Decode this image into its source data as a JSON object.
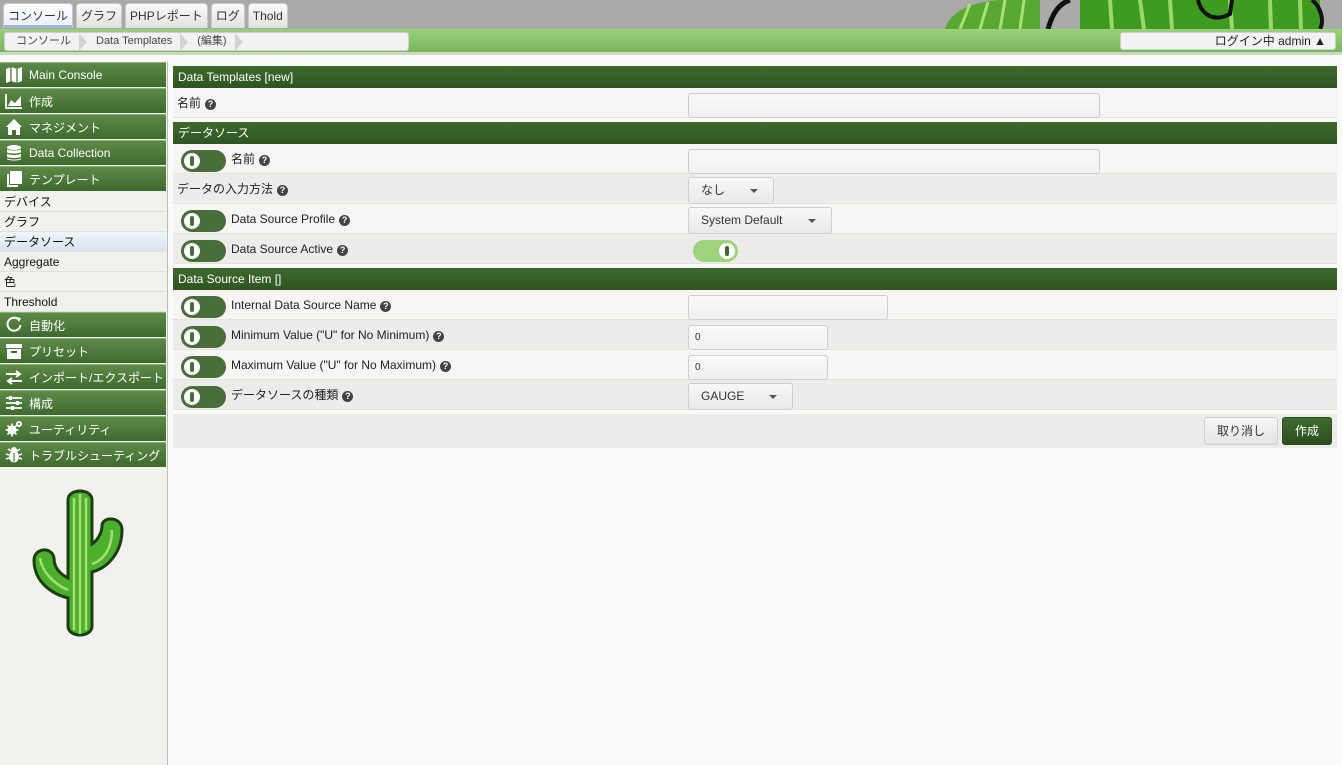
{
  "top_tabs": [
    {
      "label": "コンソール",
      "active": true
    },
    {
      "label": "グラフ"
    },
    {
      "label": "PHPレポート"
    },
    {
      "label": "ログ"
    },
    {
      "label": "Thold"
    }
  ],
  "breadcrumb": [
    "コンソール",
    "Data Templates",
    "(編集)"
  ],
  "user": {
    "label": "ログイン中 admin ▲"
  },
  "sidebar": {
    "main_console": {
      "label": "Main Console",
      "icon": "map-icon"
    },
    "create": {
      "label": "作成",
      "icon": "chart-icon"
    },
    "management": {
      "label": "マネジメント",
      "icon": "home-icon"
    },
    "data_collection": {
      "label": "Data Collection",
      "icon": "database-icon"
    },
    "templates": {
      "label": "テンプレート",
      "icon": "copy-icon"
    },
    "template_items": [
      "デバイス",
      "グラフ",
      "データソース",
      "Aggregate",
      "色",
      "Threshold"
    ],
    "automation": {
      "label": "自動化",
      "icon": "refresh-icon"
    },
    "presets": {
      "label": "プリセット",
      "icon": "archive-icon"
    },
    "import_export": {
      "label": "インポート/エクスポート",
      "icon": "exchange-icon"
    },
    "config": {
      "label": "構成",
      "icon": "sliders-icon"
    },
    "utilities": {
      "label": "ユーティリティ",
      "icon": "gears-icon"
    },
    "troubleshooting": {
      "label": "トラブルシューティング",
      "icon": "bug-icon"
    }
  },
  "main": {
    "section1_title": "Data Templates [new]",
    "template_name_label": "名前",
    "section2_title": "データソース",
    "ds_name_label": "名前",
    "input_method_label": "データの入力方法",
    "input_method_value": "なし",
    "profile_label": "Data Source Profile",
    "profile_value": "System Default",
    "active_label": "Data Source Active",
    "section3_title": "Data Source Item []",
    "internal_name_label": "Internal Data Source Name",
    "min_label": "Minimum Value (\"U\" for No Minimum)",
    "min_value": "0",
    "max_label": "Maximum Value (\"U\" for No Maximum)",
    "max_value": "0",
    "ds_type_label": "データソースの種類",
    "ds_type_value": "GAUGE",
    "cancel_label": "取り消し",
    "create_label": "作成",
    "help_glyph": "?"
  },
  "colors": {
    "accent": "#3f6a2e",
    "header_green": "#79b55a"
  }
}
